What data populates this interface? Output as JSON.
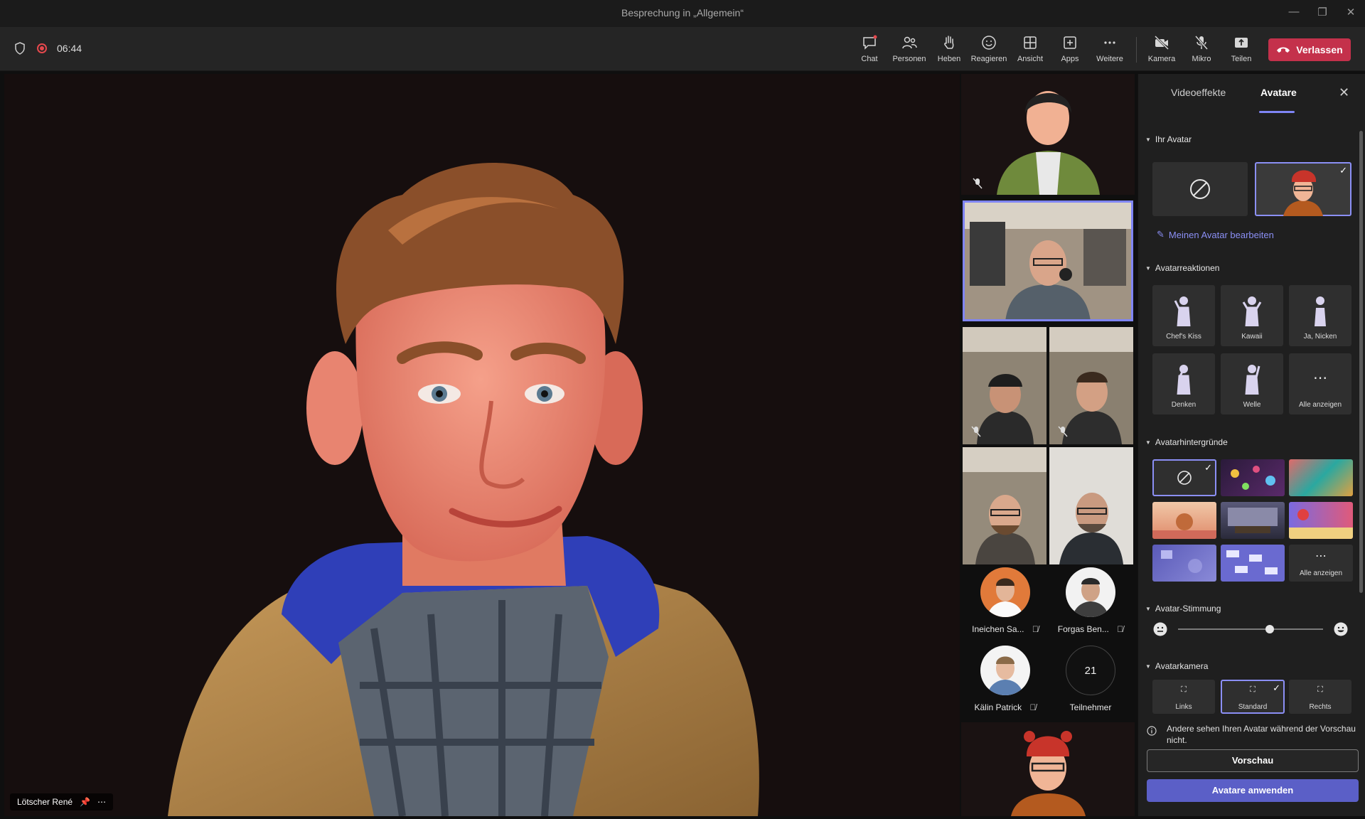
{
  "window": {
    "title": "Besprechung in „Allgemein“"
  },
  "toolbar": {
    "timer": "06:44",
    "buttons": {
      "chat": "Chat",
      "people": "Personen",
      "raise": "Heben",
      "react": "Reagieren",
      "view": "Ansicht",
      "apps": "Apps",
      "more": "Weitere",
      "camera": "Kamera",
      "mic": "Mikro",
      "share": "Teilen"
    },
    "leave": "Verlassen"
  },
  "stage": {
    "speaker_name": "Lötscher René"
  },
  "gallery": {
    "participants": [
      {
        "name": "Ineichen Sa..."
      },
      {
        "name": "Forgas Ben..."
      },
      {
        "name": "Kälin Patrick"
      }
    ],
    "overflow_count": "21",
    "overflow_label": "Teilnehmer"
  },
  "panel": {
    "tabs": [
      "Videoeffekte",
      "Avatare"
    ],
    "active_tab": "Avatare",
    "your_avatar": {
      "title": "Ihr Avatar",
      "edit_link": "Meinen Avatar bearbeiten"
    },
    "reactions": {
      "title": "Avatarreaktionen",
      "items": [
        "Chef's Kiss",
        "Kawaii",
        "Ja, Nicken",
        "Denken",
        "Welle",
        "Alle anzeigen"
      ]
    },
    "backgrounds": {
      "title": "Avatarhintergründe",
      "show_all": "Alle anzeigen"
    },
    "mood": {
      "title": "Avatar-Stimmung",
      "value": 0.63
    },
    "camera": {
      "title": "Avatarkamera",
      "options": [
        "Links",
        "Standard",
        "Rechts"
      ],
      "selected": "Standard"
    },
    "info": "Andere sehen Ihren Avatar während der Vorschau nicht.",
    "preview_button": "Vorschau",
    "apply_button": "Avatare anwenden"
  },
  "colors": {
    "accent": "#7f85f5",
    "leave": "#c4314b",
    "apply": "#5b5fc7"
  }
}
